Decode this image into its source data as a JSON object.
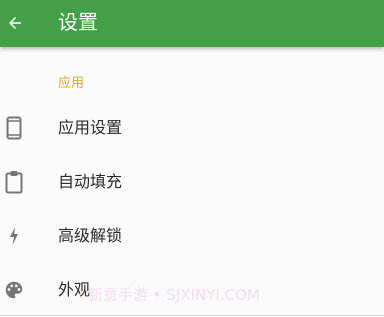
{
  "toolbar": {
    "title": "设置",
    "back_icon": "arrow-back-icon",
    "background_color": "#43a047"
  },
  "section": {
    "header": "应用",
    "header_color": "#e8a333"
  },
  "items": [
    {
      "label": "应用设置",
      "icon": "smartphone-icon"
    },
    {
      "label": "自动填充",
      "icon": "clipboard-icon"
    },
    {
      "label": "高级解锁",
      "icon": "flash-icon"
    },
    {
      "label": "外观",
      "icon": "palette-icon"
    }
  ],
  "watermark": "新意手游 • SJXINYI.COM"
}
